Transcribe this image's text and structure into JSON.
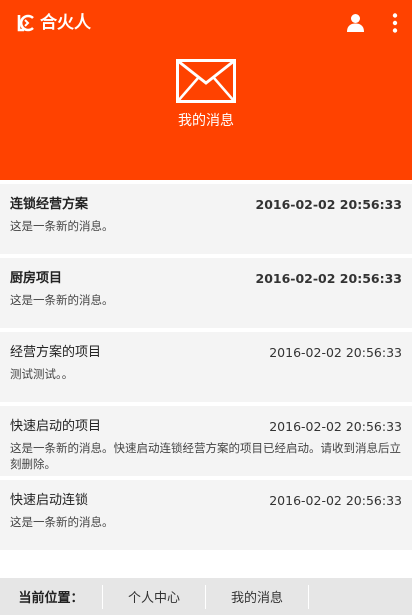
{
  "header": {
    "brand": "合火人",
    "page_title": "我的消息",
    "background_color": "#ff4200"
  },
  "messages": [
    {
      "subject": "连锁经营方案",
      "time": "2016-02-02 20:56:33",
      "body": "这是一条新的消息。",
      "unread": true
    },
    {
      "subject": "厨房项目",
      "time": "2016-02-02 20:56:33",
      "body": "这是一条新的消息。",
      "unread": true
    },
    {
      "subject": "经营方案的项目",
      "time": "2016-02-02 20:56:33",
      "body": "测试测试。。",
      "unread": false
    },
    {
      "subject": "快速启动的项目",
      "time": "2016-02-02 20:56:33",
      "body": "这是一条新的消息。快速启动连锁经营方案的项目已经启动。请收到消息后立刻删除。",
      "unread": false
    },
    {
      "subject": "快速启动连锁",
      "time": "2016-02-02 20:56:33",
      "body": "这是一条新的消息。",
      "unread": false
    }
  ],
  "breadcrumb": {
    "label": "当前位置：",
    "items": [
      "个人中心",
      "我的消息"
    ]
  },
  "icons": [
    "brand-logo-icon",
    "user-icon",
    "more-vertical-icon",
    "envelope-icon"
  ]
}
